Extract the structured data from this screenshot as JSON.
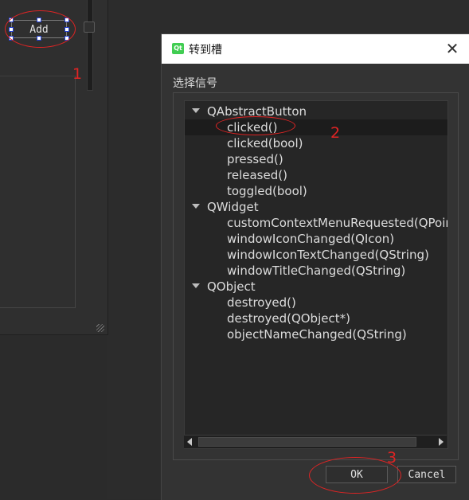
{
  "designer": {
    "add_button_label": "Add"
  },
  "annotations": {
    "step1": "1",
    "step2": "2",
    "step3": "3",
    "color": "#e02424"
  },
  "dialog": {
    "title": "转到槽",
    "icon": "qt-logo-icon",
    "logo_text": "Qt",
    "close_glyph": "✕",
    "signal_label": "选择信号",
    "tree": [
      {
        "group": "QAbstractButton",
        "items": [
          "clicked()",
          "clicked(bool)",
          "pressed()",
          "released()",
          "toggled(bool)"
        ]
      },
      {
        "group": "QWidget",
        "items": [
          "customContextMenuRequested(QPoint)",
          "windowIconChanged(QIcon)",
          "windowIconTextChanged(QString)",
          "windowTitleChanged(QString)"
        ]
      },
      {
        "group": "QObject",
        "items": [
          "destroyed()",
          "destroyed(QObject*)",
          "objectNameChanged(QString)"
        ]
      }
    ],
    "selected_item": "clicked()",
    "ok_label": "OK",
    "cancel_label": "Cancel"
  }
}
